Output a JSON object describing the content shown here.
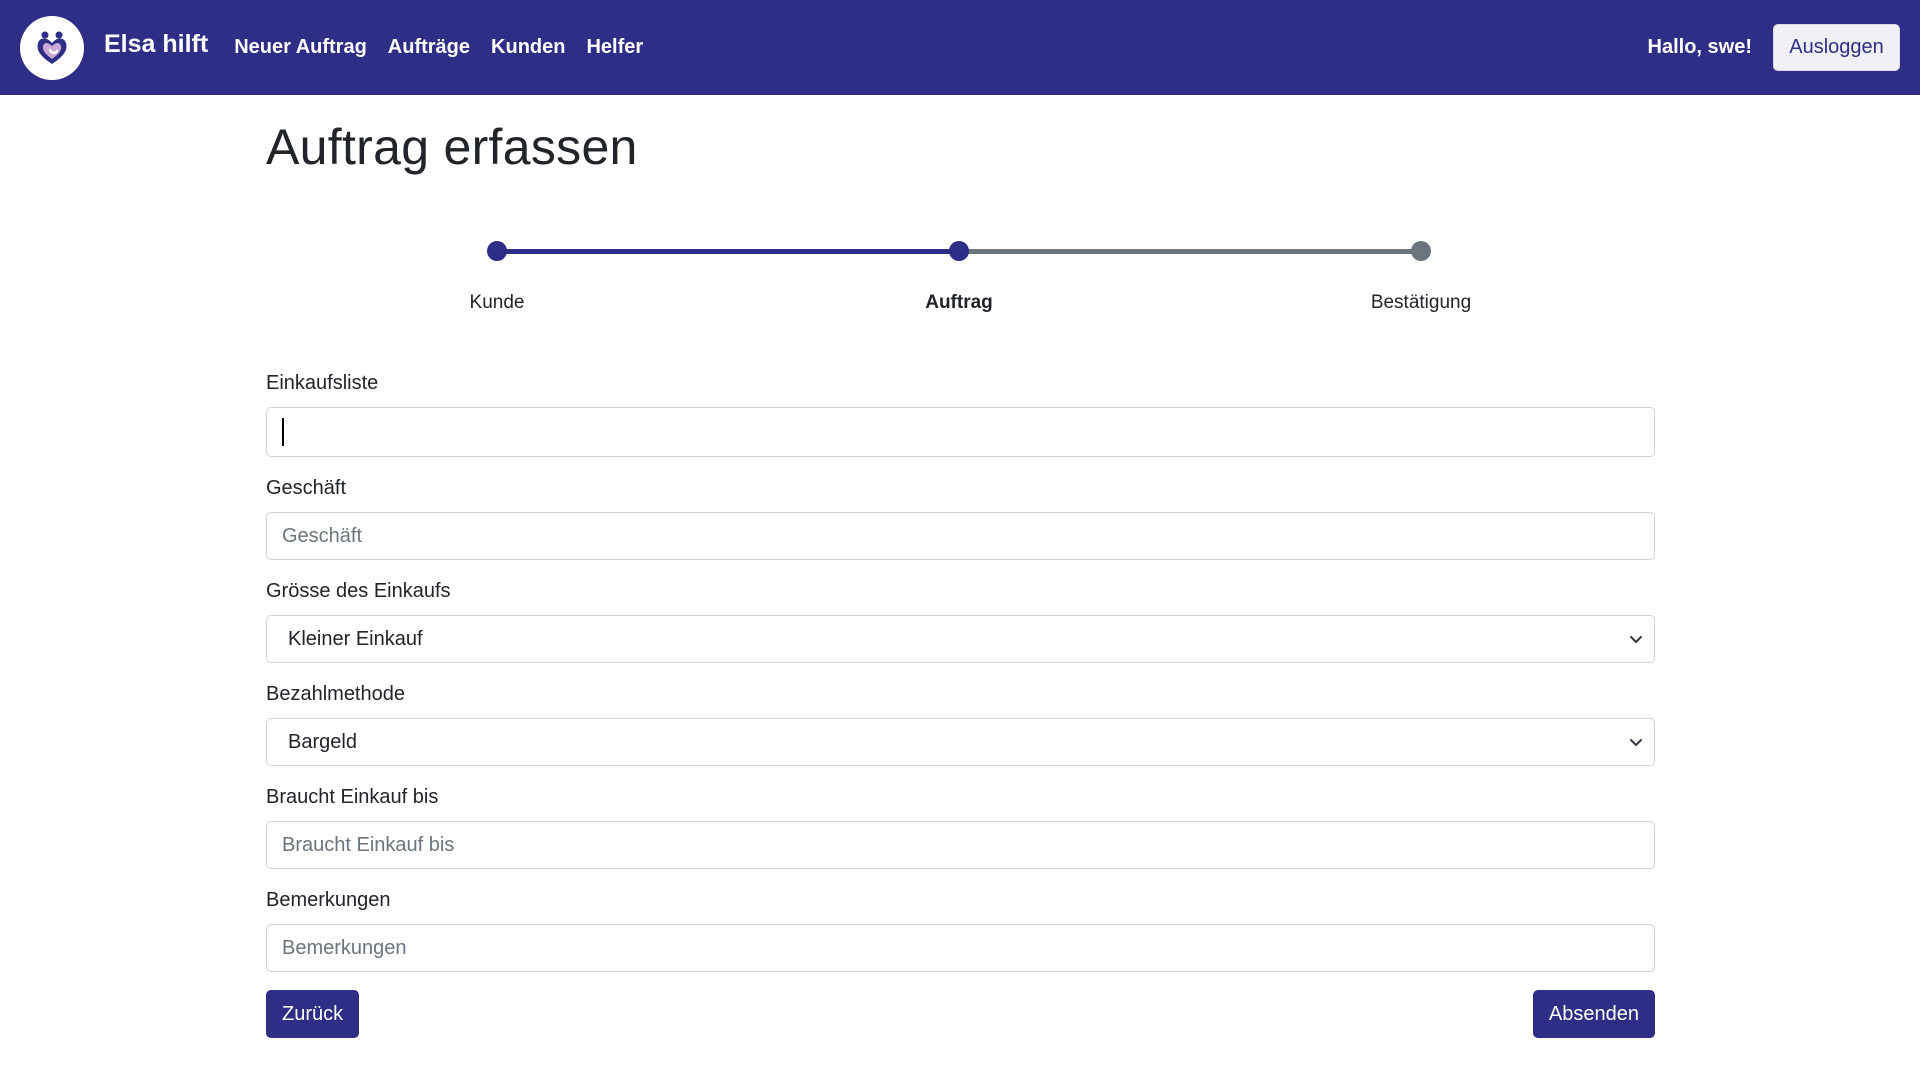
{
  "navbar": {
    "brand": "Elsa hilft",
    "links": [
      "Neuer Auftrag",
      "Aufträge",
      "Kunden",
      "Helfer"
    ],
    "greeting": "Hallo, swe!",
    "logout_label": "Ausloggen",
    "logo_icon": "heart-hands-logo-icon",
    "colors": {
      "primary": "#2e2e87",
      "inactive": "#6c757d"
    }
  },
  "page": {
    "title": "Auftrag erfassen"
  },
  "stepper": {
    "steps": [
      {
        "label": "Kunde",
        "state": "done"
      },
      {
        "label": "Auftrag",
        "state": "active"
      },
      {
        "label": "Bestätigung",
        "state": "pending"
      }
    ]
  },
  "form": {
    "einkaufsliste": {
      "label": "Einkaufsliste",
      "value": "",
      "placeholder": ""
    },
    "geschaeft": {
      "label": "Geschäft",
      "value": "",
      "placeholder": "Geschäft"
    },
    "groesse": {
      "label": "Grösse des Einkaufs",
      "selected": "Kleiner Einkauf"
    },
    "bezahlmethode": {
      "label": "Bezahlmethode",
      "selected": "Bargeld"
    },
    "braucht_bis": {
      "label": "Braucht Einkauf bis",
      "value": "",
      "placeholder": "Braucht Einkauf bis"
    },
    "bemerkungen": {
      "label": "Bemerkungen",
      "value": "",
      "placeholder": "Bemerkungen"
    }
  },
  "actions": {
    "back_label": "Zurück",
    "submit_label": "Absenden"
  }
}
